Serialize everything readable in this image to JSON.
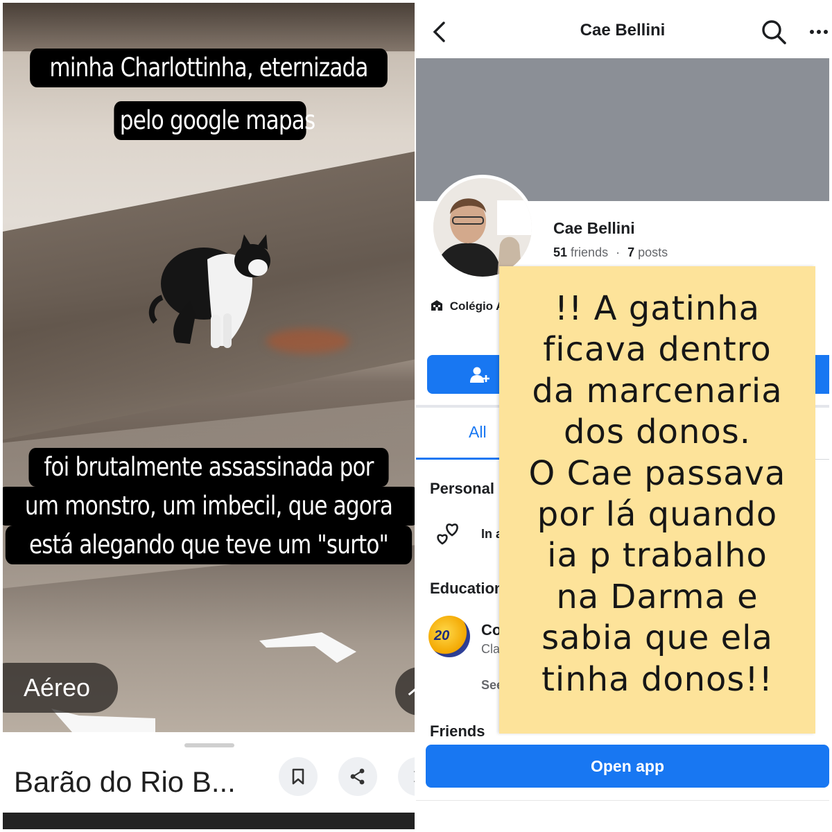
{
  "street_view": {
    "caption_top_line1": "minha Charlottinha, eternizada",
    "caption_top_line2": "pelo google mapas",
    "caption_bottom_line1": "foi brutalmente assassinada por",
    "caption_bottom_line2": "um monstro, um imbecil, que agora",
    "caption_bottom_line3": "está alegando que teve um \"surto\"",
    "mode_button_label": "Aéreo",
    "place_title": "Barão do Rio B...",
    "icons": [
      "arrow-up-icon",
      "arrow-right-icon",
      "bookmark-icon",
      "share-icon",
      "chevron-right-icon"
    ]
  },
  "facebook_profile": {
    "header_title": "Cae Bellini",
    "profile_name": "Cae Bellini",
    "friends_count": "51",
    "friends_label": "friends",
    "separator": "·",
    "posts_count": "7",
    "posts_label": "posts",
    "school_label": "Colégio A",
    "tab_all": "All",
    "section_personal": "Personal",
    "relationship_text": "In a",
    "section_education": "Education",
    "school_name_partial": "Co",
    "school_class_partial": "Cla",
    "see_partial": "See",
    "section_friends": "Friends",
    "school_logo_text": "20",
    "open_app_label": "Open app",
    "accent_color": "#1877f2",
    "icons": [
      "back-arrow-icon",
      "search-icon",
      "more-icon",
      "building-icon",
      "add-friend-icon",
      "hearts-icon"
    ]
  },
  "overlay_note": {
    "text": "!! A gatinha\nficava dentro\nda marcenaria\ndos donos.\nO Cae passava\npor lá quando\nia p trabalho\nna Darma e\nsabia que ela\ntinha donos!!",
    "background_color": "#fde39a"
  }
}
